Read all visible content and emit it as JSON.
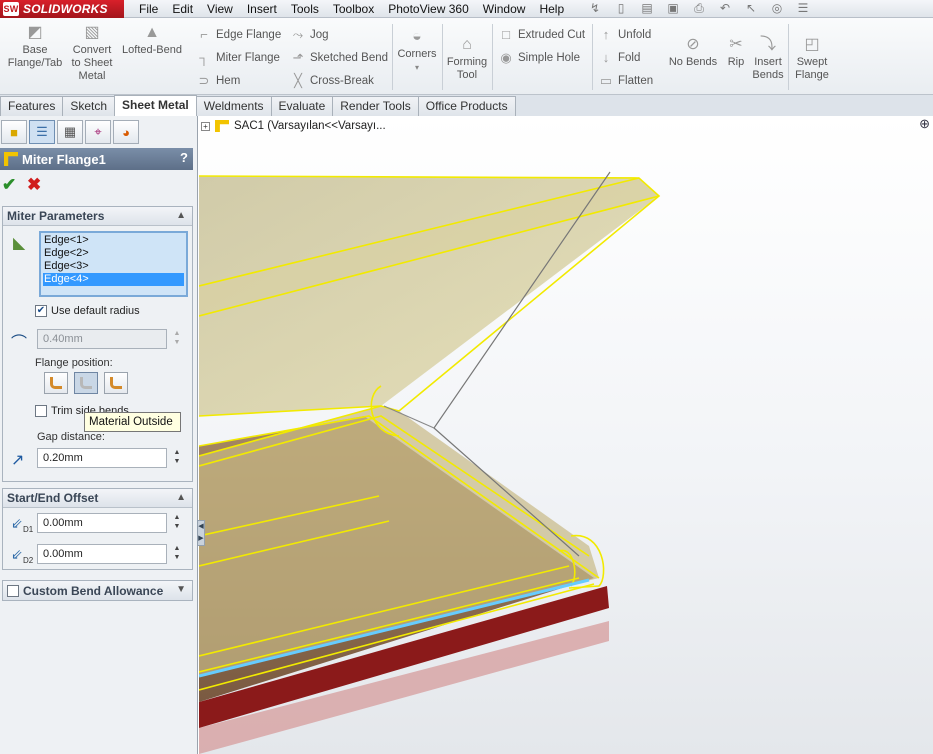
{
  "app": {
    "name": "SOLIDWORKS",
    "logo_mark": "SW"
  },
  "menu": [
    "File",
    "Edit",
    "View",
    "Insert",
    "Tools",
    "Toolbox",
    "PhotoView 360",
    "Window",
    "Help"
  ],
  "quick_access_icons": [
    "pin-icon",
    "new-document-icon",
    "open-icon",
    "save-icon",
    "print-icon",
    "undo-icon",
    "select-icon",
    "rebuild-icon",
    "options-icon"
  ],
  "ribbon": {
    "base_flange": "Base Flange/Tab",
    "convert": "Convert to Sheet Metal",
    "lofted_bend": "Lofted-Bend",
    "edge_flange": "Edge Flange",
    "miter_flange": "Miter Flange",
    "hem": "Hem",
    "jog": "Jog",
    "sketched_bend": "Sketched Bend",
    "cross_break": "Cross-Break",
    "corners": "Corners",
    "forming_tool": "Forming Tool",
    "extruded_cut": "Extruded Cut",
    "simple_hole": "Simple Hole",
    "unfold": "Unfold",
    "fold": "Fold",
    "flatten": "Flatten",
    "no_bends": "No Bends",
    "rip": "Rip",
    "insert_bends": "Insert Bends",
    "swept_flange": "Swept Flange"
  },
  "tabs": [
    "Features",
    "Sketch",
    "Sheet Metal",
    "Weldments",
    "Evaluate",
    "Render Tools",
    "Office Products"
  ],
  "active_tab": "Sheet Metal",
  "property_manager": {
    "title": "Miter Flange1",
    "help": "?",
    "ok": "✔",
    "cancel": "✖",
    "miter_parameters": {
      "header": "Miter Parameters",
      "edges": [
        "Edge<1>",
        "Edge<2>",
        "Edge<3>",
        "Edge<4>"
      ],
      "selected_edge": "Edge<4>",
      "use_default_radius_label": "Use default radius",
      "use_default_radius": true,
      "bend_radius": "0.40mm",
      "flange_position_label": "Flange position:",
      "flange_position_options": [
        "Material Inside",
        "Material Outside",
        "Bend Outside"
      ],
      "trim_side_bends_label": "Trim side bends",
      "trim_side_bends": false,
      "gap_distance_label": "Gap distance:",
      "gap_distance": "0.20mm"
    },
    "start_end_offset": {
      "header": "Start/End Offset",
      "d1_label": "D1",
      "d1": "0.00mm",
      "d2_label": "D2",
      "d2": "0.00mm"
    },
    "custom_bend_allowance": {
      "header": "Custom Bend Allowance",
      "checked": false
    }
  },
  "tooltip": "Material Outside",
  "feature_tree": {
    "item": "SAC1  (Varsayılan<<Varsayı..."
  },
  "colors": {
    "selection_yellow": "#f2ea00",
    "part_red": "#8b1a1a",
    "highlight_blue": "#66ccff",
    "accent_blue": "#3399ff"
  }
}
